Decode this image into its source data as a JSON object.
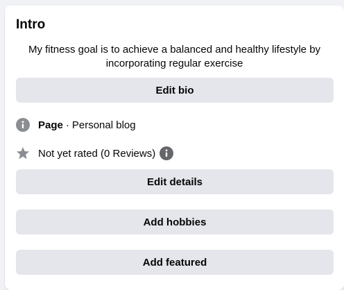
{
  "intro": {
    "title": "Intro",
    "bio": "My fitness goal is to achieve a balanced and healthy lifestyle by incorporating regular exercise",
    "edit_bio_label": "Edit bio",
    "page_label": "Page",
    "page_separator": "·",
    "page_category": "Personal blog",
    "rating_text": "Not yet rated (0 Reviews)",
    "edit_details_label": "Edit details",
    "add_hobbies_label": "Add hobbies",
    "add_featured_label": "Add featured"
  },
  "icons": {
    "page_icon": "info-icon",
    "rating_icon": "star-icon",
    "rating_info_icon": "info-icon"
  },
  "colors": {
    "button_bg": "#e4e6eb",
    "icon_gray": "#8a8d91",
    "info_dark": "#65676b",
    "page_bg": "#f0f2f5",
    "card_bg": "#ffffff"
  }
}
